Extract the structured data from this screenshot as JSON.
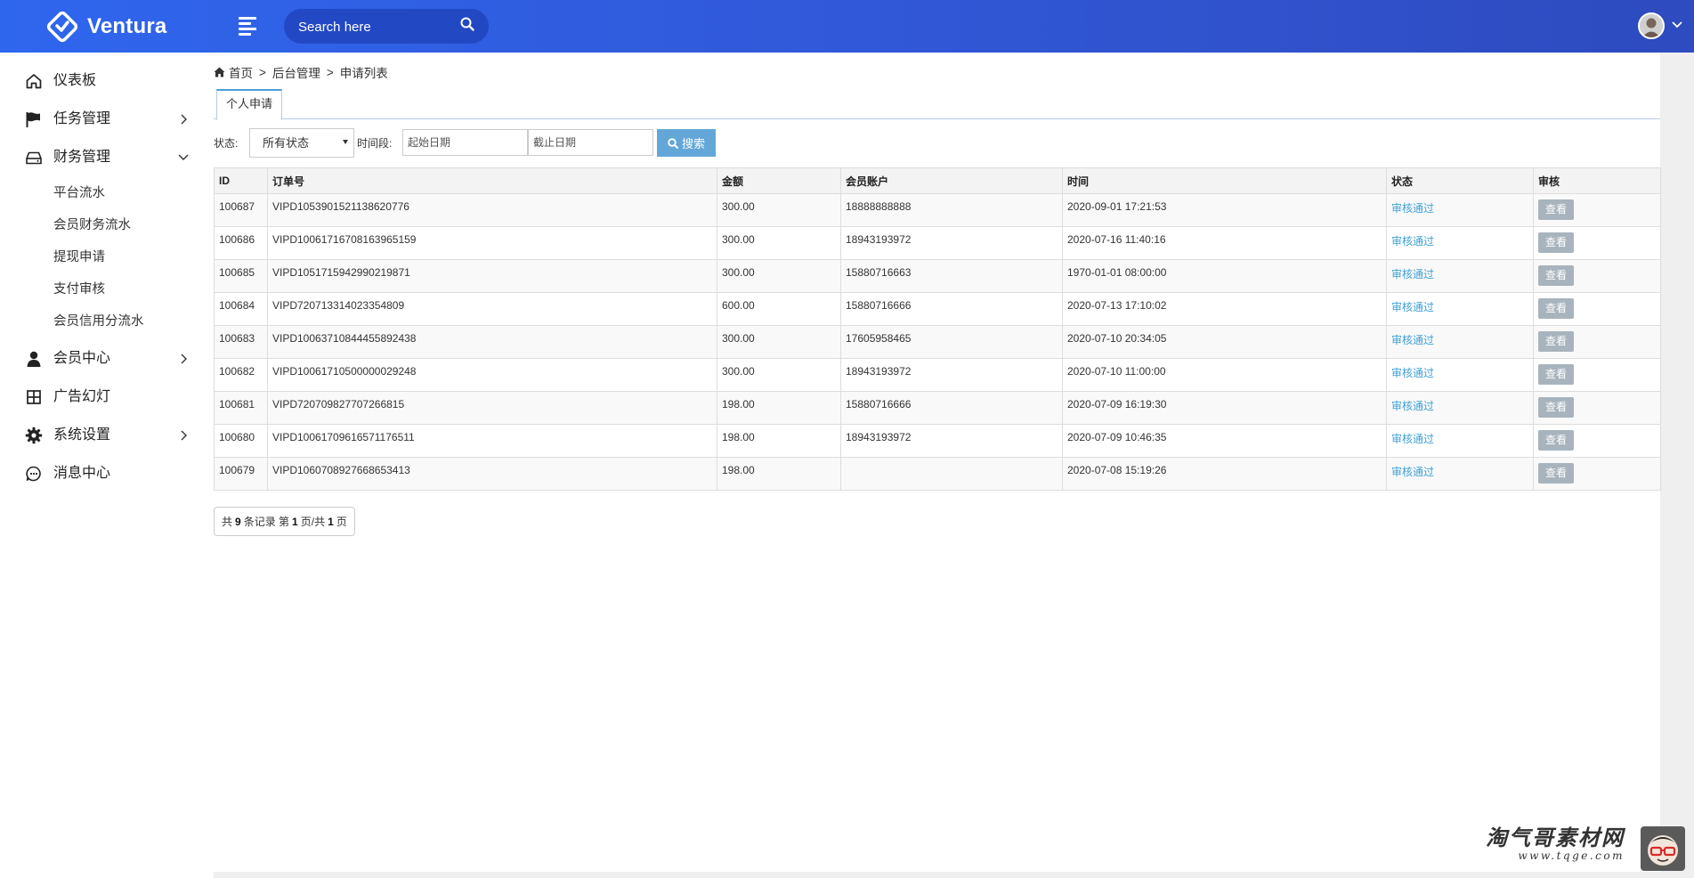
{
  "app": {
    "brand": "Ventura",
    "search_placeholder": "Search here"
  },
  "sidebar": {
    "items": [
      {
        "label": "仪表板",
        "icon": "home-icon"
      },
      {
        "label": "任务管理",
        "icon": "flag-icon"
      },
      {
        "label": "财务管理",
        "icon": "drive-icon"
      },
      {
        "label": "会员中心",
        "icon": "user-icon"
      },
      {
        "label": "广告幻灯",
        "icon": "grid-icon"
      },
      {
        "label": "系统设置",
        "icon": "gear-icon"
      },
      {
        "label": "消息中心",
        "icon": "chat-icon"
      }
    ],
    "finance_sub": [
      "平台流水",
      "会员财务流水",
      "提现申请",
      "支付审核",
      "会员信用分流水"
    ]
  },
  "breadcrumb": {
    "home": "首页",
    "sep": ">",
    "level1": "后台管理",
    "level2": "申请列表"
  },
  "tabs": {
    "active": "个人申请"
  },
  "filter": {
    "status_label": "状态:",
    "status_value": "所有状态",
    "period_label": "时间段:",
    "start_placeholder": "起始日期",
    "end_placeholder": "截止日期",
    "search_label": "搜索"
  },
  "table": {
    "headers": [
      "ID",
      "订单号",
      "金额",
      "会员账户",
      "时间",
      "状态",
      "审核"
    ],
    "rows": [
      {
        "id": "100687",
        "order": "VIPD1053901521138620776",
        "amount": "300.00",
        "account": "18888888888",
        "time": "2020-09-01 17:21:53",
        "status": "审核通过",
        "action": "查看"
      },
      {
        "id": "100686",
        "order": "VIPD10061716708163965159",
        "amount": "300.00",
        "account": "18943193972",
        "time": "2020-07-16 11:40:16",
        "status": "审核通过",
        "action": "查看"
      },
      {
        "id": "100685",
        "order": "VIPD1051715942990219871",
        "amount": "300.00",
        "account": "15880716663",
        "time": "1970-01-01 08:00:00",
        "status": "审核通过",
        "action": "查看"
      },
      {
        "id": "100684",
        "order": "VIPD720713314023354809",
        "amount": "600.00",
        "account": "15880716666",
        "time": "2020-07-13 17:10:02",
        "status": "审核通过",
        "action": "查看"
      },
      {
        "id": "100683",
        "order": "VIPD10063710844455892438",
        "amount": "300.00",
        "account": "17605958465",
        "time": "2020-07-10 20:34:05",
        "status": "审核通过",
        "action": "查看"
      },
      {
        "id": "100682",
        "order": "VIPD10061710500000029248",
        "amount": "300.00",
        "account": "18943193972",
        "time": "2020-07-10 11:00:00",
        "status": "审核通过",
        "action": "查看"
      },
      {
        "id": "100681",
        "order": "VIPD720709827707266815",
        "amount": "198.00",
        "account": "15880716666",
        "time": "2020-07-09 16:19:30",
        "status": "审核通过",
        "action": "查看"
      },
      {
        "id": "100680",
        "order": "VIPD10061709616571176511",
        "amount": "198.00",
        "account": "18943193972",
        "time": "2020-07-09 10:46:35",
        "status": "审核通过",
        "action": "查看"
      },
      {
        "id": "100679",
        "order": "VIPD1060708927668653413",
        "amount": "198.00",
        "account": "",
        "time": "2020-07-08 15:19:26",
        "status": "审核通过",
        "action": "查看"
      }
    ]
  },
  "pager": {
    "prefix": "共",
    "total": "9",
    "mid1": "条记录 第",
    "page": "1",
    "mid2": "页/共",
    "pages": "1",
    "suffix": "页"
  },
  "watermark": {
    "title": "淘气哥素材网",
    "url": "www.tqge.com"
  },
  "colors": {
    "topbar": "#2f66ee",
    "link": "#3fa0d6",
    "search_button": "#63a7d8",
    "view_button": "#a8b4bd"
  }
}
